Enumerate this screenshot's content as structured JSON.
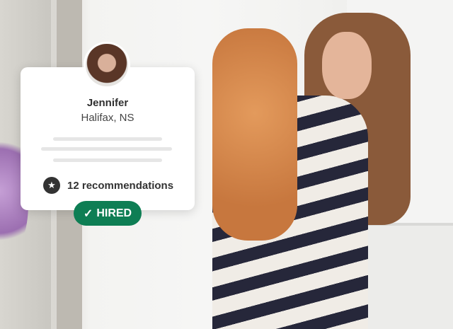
{
  "profile": {
    "name": "Jennifer",
    "location": "Halifax, NS",
    "recommendations": "12 recommendations",
    "status": "HIRED"
  },
  "icons": {
    "star": "★",
    "check": "✓"
  },
  "colors": {
    "badge": "#0e7e54",
    "star_bg": "#333333"
  }
}
